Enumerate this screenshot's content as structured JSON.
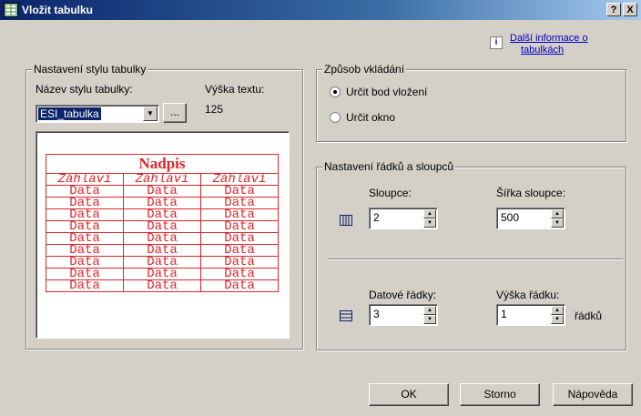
{
  "window": {
    "title": "Vložit tabulku",
    "help_btn": "?",
    "close_btn": "X"
  },
  "info_link": {
    "line1": "Další informace o",
    "line2": "tabulkách"
  },
  "style_group": {
    "legend": "Nastavení stylu tabulky",
    "name_label": "Název stylu tabulky:",
    "height_label": "Výška textu:",
    "height_value": "125",
    "style_value": "ESI_tabulka",
    "browse_btn": "..."
  },
  "preview": {
    "title": "Nadpis",
    "headers": [
      "Záhlaví",
      "Záhlaví",
      "Záhlaví"
    ],
    "rows": [
      [
        "Data",
        "Data",
        "Data"
      ],
      [
        "Data",
        "Data",
        "Data"
      ],
      [
        "Data",
        "Data",
        "Data"
      ],
      [
        "Data",
        "Data",
        "Data"
      ],
      [
        "Data",
        "Data",
        "Data"
      ],
      [
        "Data",
        "Data",
        "Data"
      ],
      [
        "Data",
        "Data",
        "Data"
      ],
      [
        "Data",
        "Data",
        "Data"
      ],
      [
        "Data",
        "Data",
        "Data"
      ]
    ],
    "color": "#e0242a"
  },
  "insert_group": {
    "legend": "Způsob vkládání",
    "opt1": "Určit bod vložení",
    "opt2": "Určit okno",
    "selected": "Určit bod vložení"
  },
  "rowcol_group": {
    "legend": "Nastavení řádků a sloupců",
    "columns_label": "Sloupce:",
    "columns_value": "2",
    "col_width_label": "Šířka sloupce:",
    "col_width_value": "500",
    "rows_label": "Datové řádky:",
    "rows_value": "3",
    "row_height_label": "Výška řádku:",
    "row_height_value": "1",
    "row_height_unit": "řádků"
  },
  "buttons": {
    "ok": "OK",
    "cancel": "Storno",
    "help": "Nápověda"
  }
}
